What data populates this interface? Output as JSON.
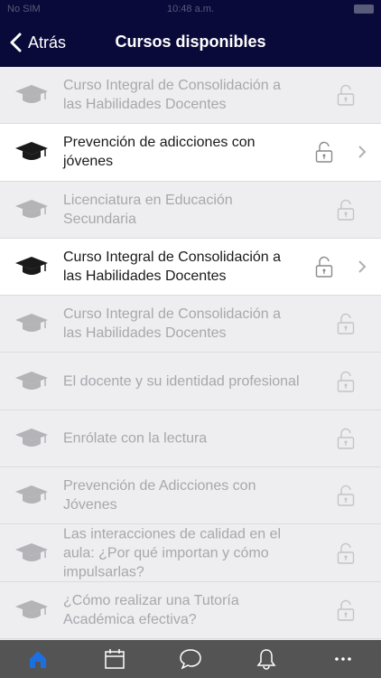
{
  "status_bar": {
    "carrier": "No SIM",
    "time": "10:48 a.m."
  },
  "nav": {
    "back_label": "Atrás",
    "title": "Cursos disponibles"
  },
  "courses": [
    {
      "title": "Curso Integral de Consolidación a las Habilidades Docentes",
      "enabled": false
    },
    {
      "title": "Prevención de adicciones con jóvenes",
      "enabled": true
    },
    {
      "title": "Licenciatura en Educación Secundaria",
      "enabled": false
    },
    {
      "title": "Curso Integral de Consolidación a las Habilidades Docentes",
      "enabled": true
    },
    {
      "title": "Curso Integral de Consolidación a las Habilidades Docentes",
      "enabled": false
    },
    {
      "title": "El docente y su identidad profesional",
      "enabled": false
    },
    {
      "title": "Enrólate con la lectura",
      "enabled": false
    },
    {
      "title": "Prevención de Adicciones con Jóvenes",
      "enabled": false
    },
    {
      "title": "Las interacciones de calidad en el aula: ¿Por qué importan y cómo impulsarlas?",
      "enabled": false
    },
    {
      "title": "¿Cómo realizar una Tutoría Académica efectiva?",
      "enabled": false
    }
  ],
  "tabs": [
    {
      "icon": "home-icon",
      "active": true
    },
    {
      "icon": "calendar-icon",
      "active": false
    },
    {
      "icon": "chat-icon",
      "active": false
    },
    {
      "icon": "bell-icon",
      "active": false
    },
    {
      "icon": "more-icon",
      "active": false
    }
  ],
  "colors": {
    "nav_bg": "#0a0a3a",
    "tab_bg": "#545454",
    "tab_active": "#1d6fe0",
    "tab_icon": "#ffffff"
  }
}
